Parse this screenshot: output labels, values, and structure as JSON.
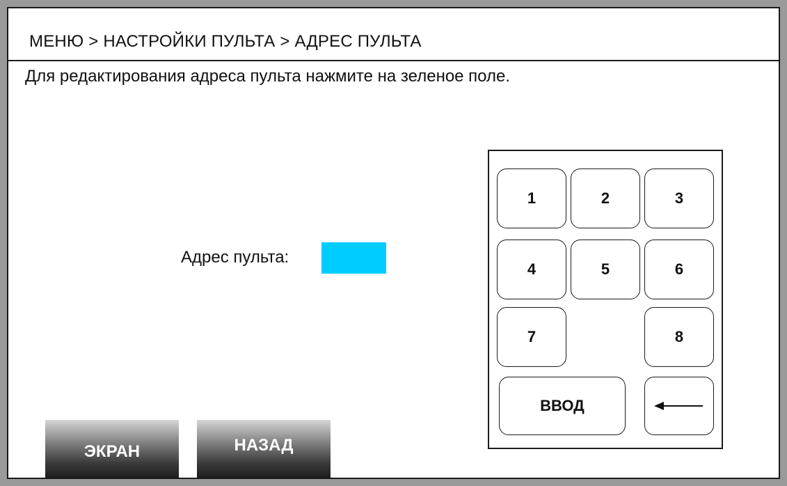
{
  "header": {
    "breadcrumb": "МЕНЮ > НАСТРОЙКИ ПУЛЬТА > АДРЕС ПУЛЬТА"
  },
  "instruction": "Для редактирования адреса пульта нажмите на зеленое поле.",
  "address": {
    "label": "Адрес пульта:",
    "value": "",
    "field_color": "#00ccff"
  },
  "keypad": {
    "keys": [
      "1",
      "2",
      "3",
      "4",
      "5",
      "6",
      "7",
      "8"
    ],
    "enter_label": "ВВОД",
    "backspace_icon": "left-arrow-icon"
  },
  "footer": {
    "screen_label": "ЭКРАН",
    "back_label": "НАЗАД"
  }
}
